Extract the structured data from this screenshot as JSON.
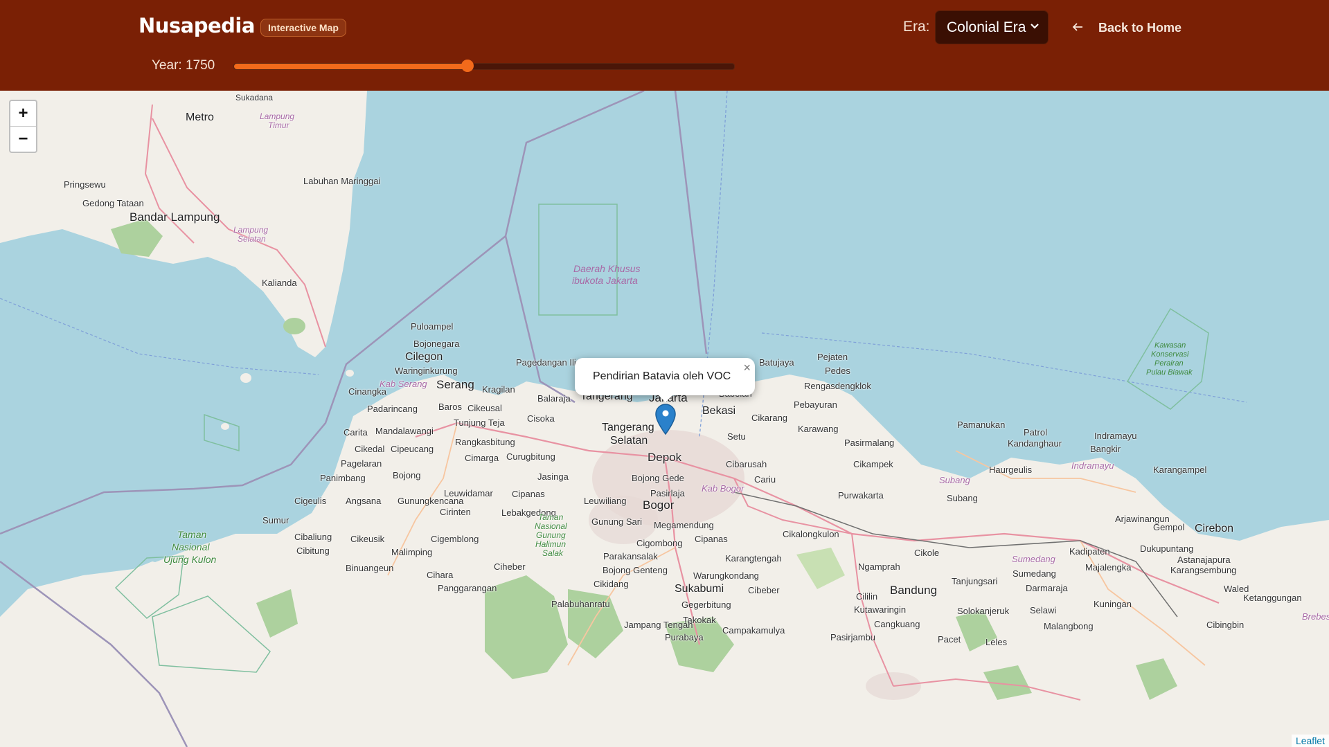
{
  "header": {
    "brand": "Nusapedia",
    "badge": "Interactive Map",
    "era_label": "Era:",
    "era_selected": "Colonial Era",
    "back_label": "Back to Home",
    "year_label": "Year: 1750",
    "year_slider_fraction": 0.467
  },
  "map": {
    "zoom_in": "+",
    "zoom_out": "−",
    "popup_text": "Pendirian Batavia oleh VOC",
    "popup_close": "×",
    "attribution": "Leaflet",
    "region_label_1": "Daerah Khusus",
    "region_label_2": "ibukota Jakarta",
    "places": {
      "metro": "Metro",
      "sukadana": "Sukadana",
      "lampung_timur_1": "Lampung",
      "lampung_timur_2": "Timur",
      "labuhan": "Labuhan Maringgai",
      "pringsewu": "Pringsewu",
      "gedong": "Gedong Tataan",
      "bandar_lampung": "Bandar Lampung",
      "lampung_selatan_1": "Lampung",
      "lampung_selatan_2": "Selatan",
      "kalianda": "Kalianda",
      "pulo": "Puloampel",
      "bojonegara": "Bojonegara",
      "cilegon": "Cilegon",
      "waringin": "Waringinkurung",
      "kab_serang": "Kab Serang",
      "serang": "Serang",
      "kragilan": "Kragilan",
      "pagedangan": "Pagedangan Ilir",
      "cinangka": "Cinangka",
      "padarincang": "Padarincang",
      "baros": "Baros",
      "cikeusal": "Cikeusal",
      "balaraja": "Balaraja",
      "tangerang": "Tangerang",
      "jakarta": "Jakarta",
      "babelan": "Babelan",
      "bekasi": "Bekasi",
      "batujaya": "Batujaya",
      "pejaten": "Pejaten",
      "pedes": "Pedes",
      "rengas": "Rengasdengklok",
      "pebayuran": "Pebayuran",
      "carita": "Carita",
      "mandalawangi": "Mandalawangi",
      "tunjung": "Tunjung Teja",
      "cisoka": "Cisoka",
      "tangsel_1": "Tangerang",
      "tangsel_2": "Selatan",
      "cikarang": "Cikarang",
      "karawang": "Karawang",
      "pamanukan": "Pamanukan",
      "patrol": "Patrol",
      "indramayu": "Indramayu",
      "kawasan_1": "Kawasan",
      "kawasan_2": "Konservasi",
      "kawasan_3": "Perairan",
      "kawasan_4": "Pulau Biawak",
      "cikedal": "Cikedal",
      "cipeucang": "Cipeucang",
      "rangkas": "Rangkasbitung",
      "setu": "Setu",
      "pasirmalang": "Pasirmalang",
      "kandanghaur": "Kandanghaur",
      "bangkir": "Bangkir",
      "pagelaran": "Pagelaran",
      "cimarga": "Cimarga",
      "curugbitung": "Curugbitung",
      "depok": "Depok",
      "cibarusah": "Cibarusah",
      "cikampek": "Cikampek",
      "haurgeulis": "Haurgeulis",
      "indramayu_kab": "Indramayu",
      "karangampel": "Karangampel",
      "panimbang": "Panimbang",
      "bojong": "Bojong",
      "jasinga": "Jasinga",
      "bojong_gede": "Bojong Gede",
      "cariu": "Cariu",
      "subang_kab": "Subang",
      "leuwidamar": "Leuwidamar",
      "cipanas1": "Cipanas",
      "pasirlaja": "Pasirlaja",
      "kab_bogor": "Kab Bogor",
      "purwakarta": "Purwakarta",
      "subang": "Subang",
      "cigeulis": "Cigeulis",
      "angsana": "Angsana",
      "gunungkencana": "Gunungkencana",
      "leuwiliang": "Leuwiliang",
      "bogor": "Bogor",
      "arjawinangun": "Arjawinangun",
      "lebak": "Lebakgedong",
      "cirinten": "Cirinten",
      "sumur": "Sumur",
      "gunung_sari": "Gunung Sari",
      "megamendung": "Megamendung",
      "gempol": "Gempol",
      "cirebon": "Cirebon",
      "taman_1": "Taman",
      "taman_2": "Nasional",
      "taman_3": "Ujung Kulon",
      "cibaliung": "Cibaliung",
      "cikeusik": "Cikeusik",
      "cigemblong": "Cigemblong",
      "cigombong": "Cigombong",
      "cipanas2": "Cipanas",
      "cikalongkulon": "Cikalongkulon",
      "cikole": "Cikole",
      "kadipaten": "Kadipaten",
      "dukupuntang": "Dukupuntang",
      "cibitung": "Cibitung",
      "malimping": "Malimping",
      "parakansalak": "Parakansalak",
      "karangtengah": "Karangtengah",
      "ngamprah": "Ngamprah",
      "sumedang": "Sumedang",
      "sumedang2": "Sumedang",
      "majalengka": "Majalengka",
      "astana": "Astanajapura",
      "karangsembung": "Karangsembung",
      "binuangeun": "Binuangeun",
      "ciheber": "Ciheber",
      "bojong_genteng": "Bojong Genteng",
      "warung": "Warungkondang",
      "tanjungsari": "Tanjungsari",
      "cihara": "Cihara",
      "cikidang": "Cikidang",
      "sukabumi": "Sukabumi",
      "cibeber": "Cibeber",
      "bandung": "Bandung",
      "darmaraja": "Darmaraja",
      "waled": "Waled",
      "panggarangan": "Panggarangan",
      "gegerbitung": "Gegerbitung",
      "cililin": "Cililin",
      "kuningan": "Kuningan",
      "kutawaringin": "Kutawaringin",
      "solokan": "Solokanjeruk",
      "selawi": "Selawi",
      "palabuhan": "Palabuhanratu",
      "takokak": "Takokak",
      "cangkuang": "Cangkuang",
      "cibingbin": "Cibingbin",
      "jampang": "Jampang Tengah",
      "campaka": "Campakamulya",
      "pasirjambu": "Pasirjambu",
      "malangbong": "Malangbong",
      "purabaya": "Purabaya",
      "pacet": "Pacet",
      "leles": "Leles",
      "taman_gh_1": "Taman",
      "taman_gh_2": "Nasional",
      "taman_gh_3": "Gunung",
      "taman_gh_4": "Halimun",
      "taman_gh_5": "Salak",
      "ketanggungan": "Ketanggungan",
      "brebes": "Brebes",
      "rangkasbitung_lbl": "Rangkasbitung"
    }
  },
  "colors": {
    "header_bg": "#7a2005",
    "accent": "#f26a1b",
    "water": "#aad3df",
    "land": "#f2efe9",
    "forest": "#add19e",
    "road": "#e892a2"
  },
  "icons": {
    "back": "arrow-left-icon",
    "marker": "map-marker-icon",
    "dropdown": "chevron-down-icon"
  }
}
